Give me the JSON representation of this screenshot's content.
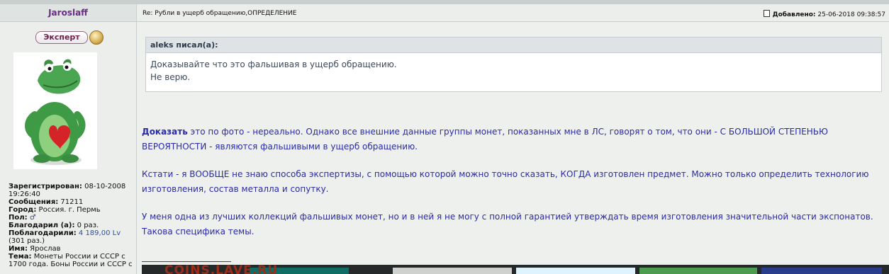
{
  "author": {
    "name": "Jaroslaff",
    "badge": "Эксперт"
  },
  "profile": [
    {
      "label": "Зарегистрирован:",
      "value": "08-10-2008 19:26:40"
    },
    {
      "label": "Сообщения:",
      "value": "71211"
    },
    {
      "label": "Город:",
      "value": "Россия. г. Пермь"
    },
    {
      "label": "Пол:",
      "value": "♂"
    },
    {
      "label": "Благодарил (а):",
      "value": "0 раз."
    },
    {
      "label": "Поблагодарили:",
      "value": "4 189,00 Lv",
      "value2": "(301 раз.)"
    },
    {
      "label": "Имя:",
      "value": "Ярослав"
    },
    {
      "label": "Тема:",
      "value": "Монеты России и СССР с 1700 года. Боны России и СССР с"
    }
  ],
  "post": {
    "subject": "Re: Рубли в ущерб обращению,ОПРЕДЕЛЕНИЕ",
    "added_label": "Добавлено:",
    "added_date": "25-06-2018 09:38:57"
  },
  "quote": {
    "header": "aleks писал(а):",
    "line1": "Доказывайте что это фальшивая в ущерб обращению.",
    "line2": "Не верю."
  },
  "message": {
    "p1_bold": "Доказать",
    "p1_rest": " это по фото - нереально. Однако все внешние данные группы монет, показанных мне в ЛС, говорят о том, что они - С БОЛЬШОЙ СТЕПЕНЬЮ ВЕРОЯТНОСТИ - являются фальшивыми в ущерб обращению.",
    "p2": "Кстати - я ВООБЩЕ не знаю способа экспертизы, с помощью которой можно точно сказать, КОГДА изготовлен предмет. Можно только определить технологию изготовления, состав металла и сопутку.",
    "p3": "У меня одна из лучших коллекций фальшивых монет, но и в ней я не могу с полной гарантией утверждать время изготовления значительной части экспонатов. Такова специфика темы."
  },
  "watermark": "COINS.LAVE.RU",
  "colors": {
    "author": "#6a2d86",
    "message_text": "#2a2aa8",
    "quote_text": "#3c4a5a",
    "link": "#2e4f9e"
  },
  "icons": [
    "medal-icon",
    "male-gender-icon",
    "post-doc-icon"
  ]
}
